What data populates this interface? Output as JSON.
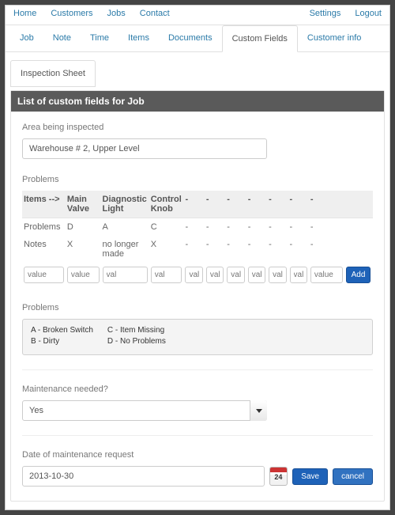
{
  "topnav": {
    "left": [
      "Home",
      "Customers",
      "Jobs",
      "Contact"
    ],
    "right": [
      "Settings",
      "Logout"
    ]
  },
  "subnav": {
    "items": [
      "Job",
      "Note",
      "Time",
      "Items",
      "Documents",
      "Custom Fields",
      "Customer info"
    ],
    "active_index": 5
  },
  "subtab": {
    "label": "Inspection Sheet"
  },
  "panel": {
    "title": "List of custom fields for Job"
  },
  "area": {
    "label": "Area being inspected",
    "value": "Warehouse # 2, Upper Level"
  },
  "problems_table": {
    "heading": "Problems",
    "row_header": "Items -->",
    "columns": [
      "Main Valve",
      "Diagnostic Light",
      "Control Knob",
      "-",
      "-",
      "-",
      "-",
      "-",
      "-",
      "-"
    ],
    "rows": [
      {
        "label": "Problems",
        "cells": [
          "D",
          "A",
          "C",
          "-",
          "-",
          "-",
          "-",
          "-",
          "-",
          "-"
        ]
      },
      {
        "label": "Notes",
        "cells": [
          "X",
          "no longer made",
          "X",
          "-",
          "-",
          "-",
          "-",
          "-",
          "-",
          "-"
        ]
      }
    ],
    "input_placeholders": [
      "value",
      "value",
      "val",
      "val",
      "val",
      "val",
      "val",
      "val",
      "val",
      "val",
      "value"
    ],
    "add_label": "Add"
  },
  "legend": {
    "heading": "Problems",
    "colA": [
      "A - Broken Switch",
      "B - Dirty"
    ],
    "colB": [
      "C - Item Missing",
      "D - No Problems"
    ]
  },
  "maintenance": {
    "label": "Maintenance needed?",
    "value": "Yes"
  },
  "date": {
    "label": "Date of maintenance request",
    "value": "2013-10-30",
    "cal_day": "24"
  },
  "buttons": {
    "save": "Save",
    "cancel": "cancel"
  }
}
